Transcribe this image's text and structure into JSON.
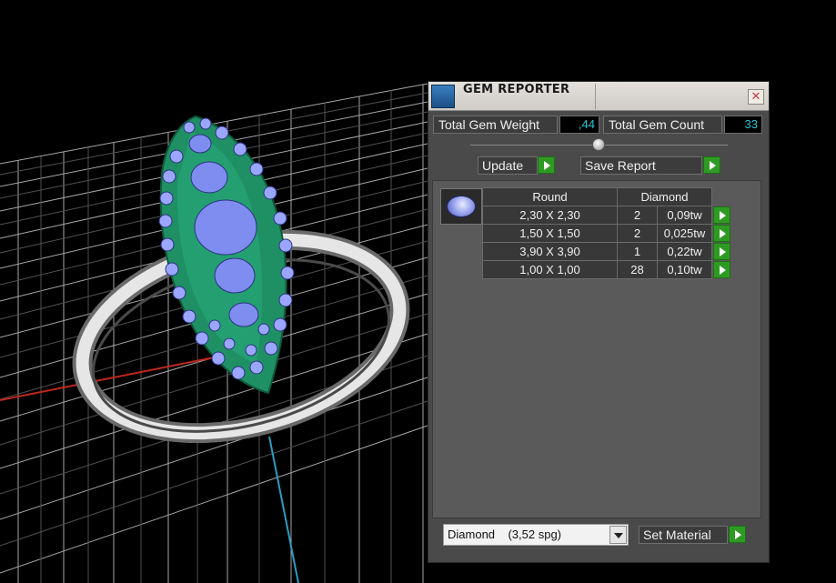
{
  "window": {
    "title": "GEM REPORTER",
    "close_glyph": "✕"
  },
  "totals": {
    "gem_weight_label": "Total Gem Weight",
    "gem_weight_value": ",44",
    "gem_count_label": "Total Gem Count",
    "gem_count_value": "33"
  },
  "actions": {
    "update_label": "Update",
    "save_report_label": "Save Report",
    "set_material_label": "Set Material"
  },
  "report": {
    "shape_header": "Round",
    "material_header": "Diamond",
    "rows": [
      {
        "size": "2,30 X 2,30",
        "count": "2",
        "weight": "0,09tw"
      },
      {
        "size": "1,50 X 1,50",
        "count": "2",
        "weight": "0,025tw"
      },
      {
        "size": "3,90 X 3,90",
        "count": "1",
        "weight": "0,22tw"
      },
      {
        "size": "1,00 X 1,00",
        "count": "28",
        "weight": "0,10tw"
      }
    ]
  },
  "material_select": {
    "value": "Diamond    (3,52 spg)"
  },
  "colors": {
    "value_text": "#29c6d8",
    "accent_green": "#2f9a23",
    "ring_metal": "#1f8f64",
    "grid": "#bdbdbd"
  },
  "icons": {
    "app": "gem-reporter-icon",
    "close": "close-icon",
    "arrow": "play-arrow-icon",
    "gem": "round-diamond-icon",
    "dropdown": "chevron-down-icon"
  }
}
